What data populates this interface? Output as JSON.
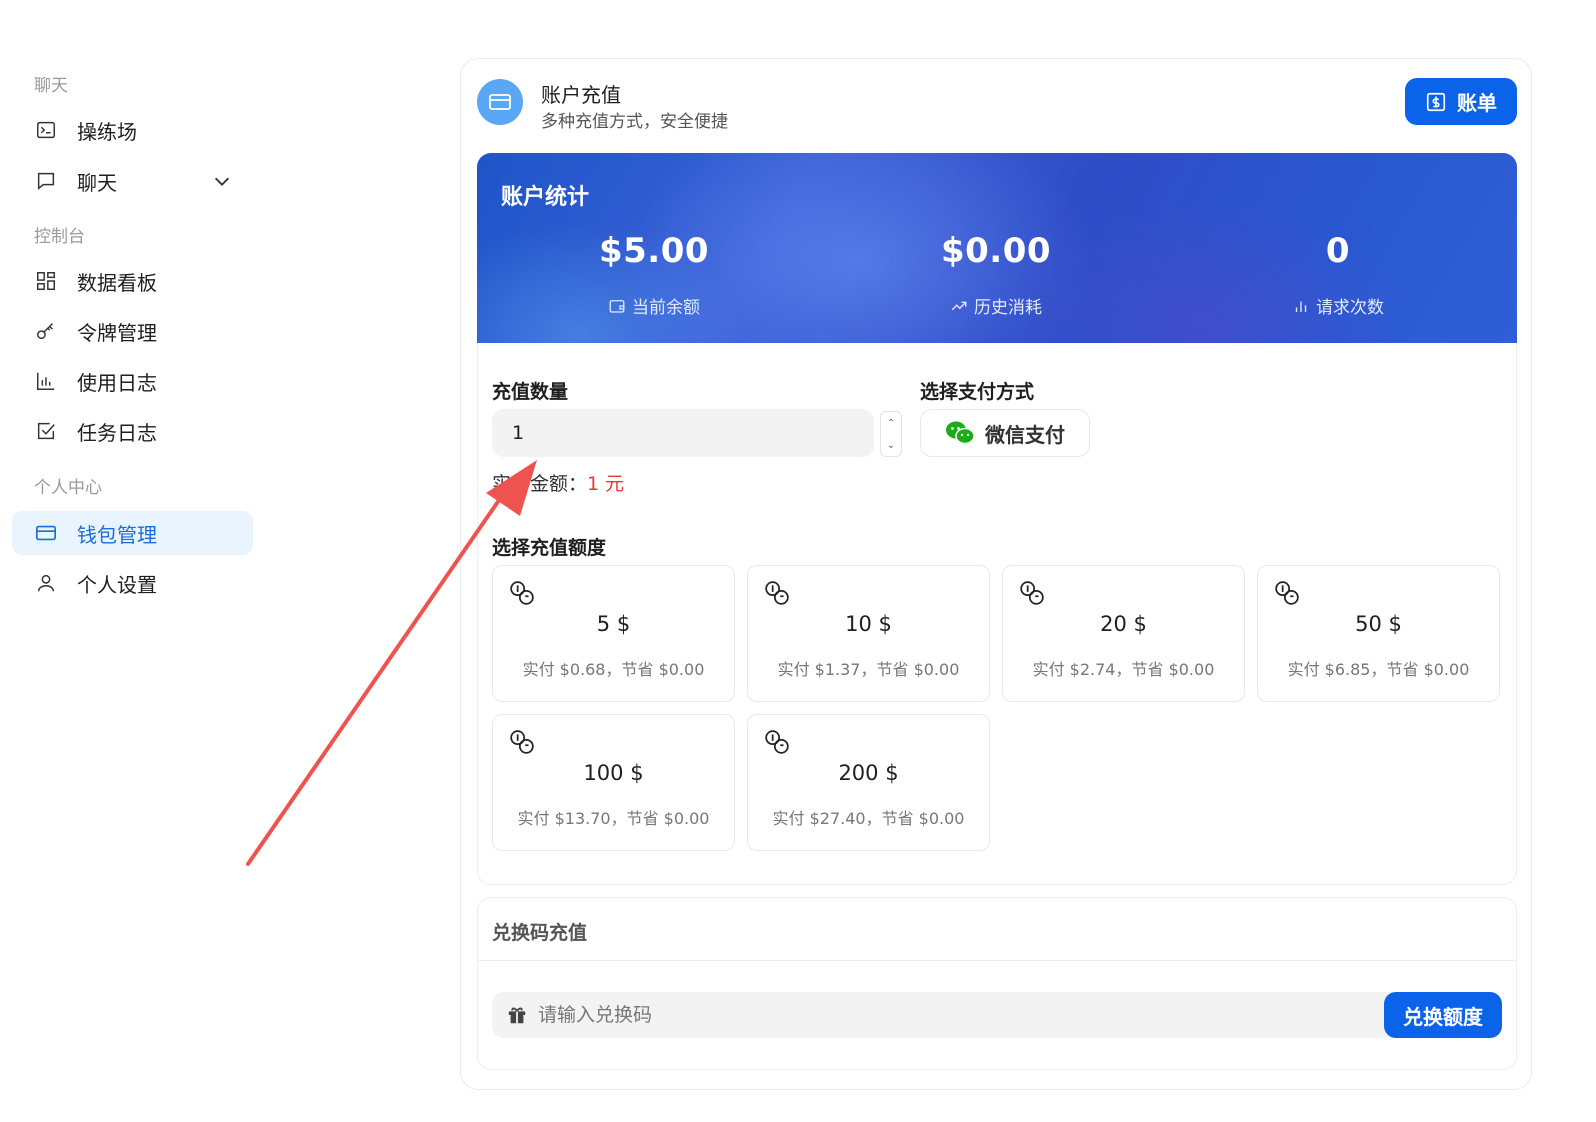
{
  "sidebar": {
    "sections": [
      "聊天",
      "控制台",
      "个人中心"
    ],
    "items": [
      {
        "label": "操练场"
      },
      {
        "label": "聊天"
      },
      {
        "label": "数据看板"
      },
      {
        "label": "令牌管理"
      },
      {
        "label": "使用日志"
      },
      {
        "label": "任务日志"
      },
      {
        "label": "钱包管理"
      },
      {
        "label": "个人设置"
      }
    ]
  },
  "header": {
    "title": "账户充值",
    "subtitle": "多种充值方式，安全便捷",
    "bill_label": "账单"
  },
  "stats": {
    "title": "账户统计",
    "items": [
      {
        "value": "$5.00",
        "label": "当前余额"
      },
      {
        "value": "$0.00",
        "label": "历史消耗"
      },
      {
        "value": "0",
        "label": "请求次数"
      }
    ]
  },
  "recharge": {
    "quantity_label": "充值数量",
    "quantity_value": "1",
    "pay_amount_prefix": "实付金额：",
    "pay_amount_value": "1 元",
    "payment_label": "选择支付方式",
    "payment_method": "微信支付",
    "amounts_label": "选择充值额度",
    "amounts": [
      {
        "amount": "5 $",
        "detail": "实付 $0.68，节省 $0.00"
      },
      {
        "amount": "10 $",
        "detail": "实付 $1.37，节省 $0.00"
      },
      {
        "amount": "20 $",
        "detail": "实付 $2.74，节省 $0.00"
      },
      {
        "amount": "50 $",
        "detail": "实付 $6.85，节省 $0.00"
      },
      {
        "amount": "100 $",
        "detail": "实付 $13.70，节省 $0.00"
      },
      {
        "amount": "200 $",
        "detail": "实付 $27.40，节省 $0.00"
      }
    ]
  },
  "redeem": {
    "title": "兑换码充值",
    "placeholder": "请输入兑换码",
    "button_label": "兑换额度"
  },
  "colors": {
    "accent": "#0a63e8",
    "active_bg": "#eaf4ff",
    "active_text": "#1a6dd7",
    "price_red": "#e53935",
    "arrow": "#ef5350",
    "wechat_green": "#1aad19"
  }
}
